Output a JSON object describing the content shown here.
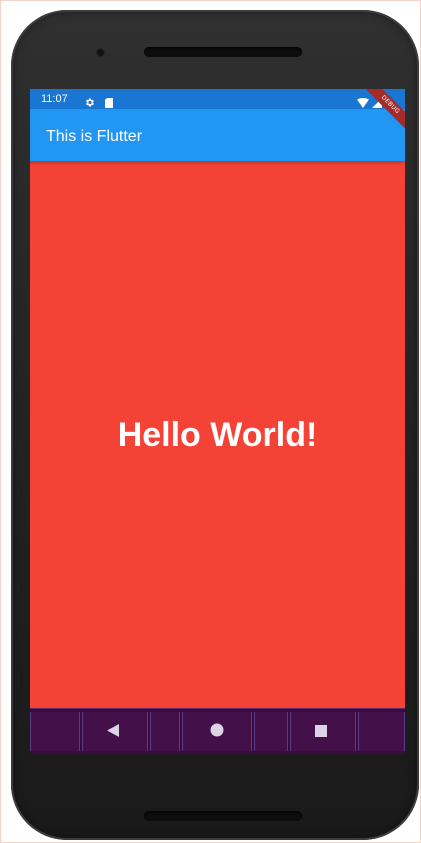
{
  "status_bar": {
    "time": "11:07",
    "left_icons": [
      "settings-icon",
      "sim-card-icon"
    ],
    "right_icons": [
      "wifi-icon",
      "signal-icon",
      "battery-icon"
    ],
    "background": "#1976d2"
  },
  "app_bar": {
    "title": "This is Flutter",
    "background": "#2196f3"
  },
  "debug_banner": {
    "label": "DEBUG",
    "color": "#a52a2a"
  },
  "body": {
    "text": "Hello World!",
    "background": "#f44336",
    "text_color": "#ffffff"
  },
  "navigation_bar": {
    "buttons": [
      "back-icon",
      "home-icon",
      "recents-icon"
    ],
    "background": "#3d0a3e"
  }
}
